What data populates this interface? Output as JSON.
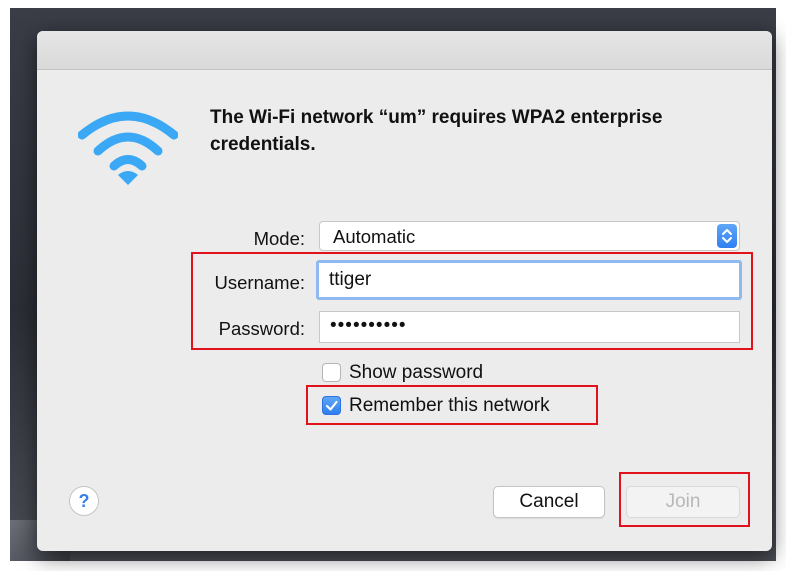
{
  "dialog": {
    "message": "The Wi-Fi network “um” requires WPA2 enterprise credentials."
  },
  "form": {
    "mode_label": "Mode:",
    "mode_value": "Automatic",
    "username_label": "Username:",
    "username_value": "ttiger",
    "password_label": "Password:",
    "password_value": "••••••••••",
    "show_password_label": "Show password",
    "show_password_checked": false,
    "remember_label": "Remember this network",
    "remember_checked": true
  },
  "buttons": {
    "help_label": "?",
    "cancel_label": "Cancel",
    "join_label": "Join",
    "join_enabled": false
  },
  "colors": {
    "wifi_blue": "#3aa8f5",
    "highlight_red": "#e0121b",
    "accent_blue": "#2f7ff0"
  },
  "icons": {
    "wifi": "wifi-icon",
    "stepper": "chevron-updown-icon",
    "check": "checkmark-icon",
    "help": "question-mark-icon"
  }
}
